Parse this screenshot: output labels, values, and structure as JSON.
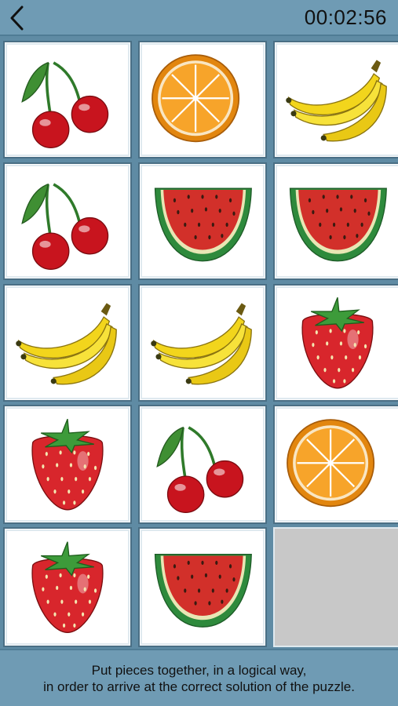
{
  "header": {
    "back_icon": "chevron-left-icon",
    "timer": "00:02:56"
  },
  "board": {
    "rows": 5,
    "cols": 3,
    "tiles": [
      "cherry",
      "orange",
      "banana",
      "cherry",
      "watermelon",
      "watermelon",
      "banana",
      "banana",
      "strawberry",
      "strawberry",
      "cherry",
      "orange",
      "strawberry",
      "watermelon",
      "empty"
    ],
    "empty_color": "#c8c8c8"
  },
  "instructions": {
    "line1": "Put pieces together, in a logical way,",
    "line2": "in order to arrive at the correct solution of the puzzle."
  },
  "colors": {
    "bar": "#6f9bb4",
    "cherry": "#c8141e",
    "orange": "#f39a1e",
    "banana": "#f2d51c",
    "watermelon_flesh": "#d2302a",
    "watermelon_rind": "#2e8a3c",
    "strawberry": "#d8262c",
    "leaf": "#3d9b3a"
  }
}
